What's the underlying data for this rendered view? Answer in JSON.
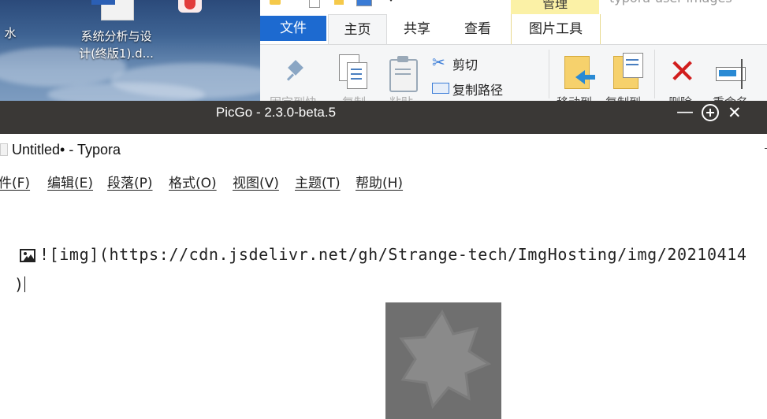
{
  "desktop": {
    "icons": [
      {
        "label_line1": "系统分析与设",
        "label_line2": "计(终版1).d..."
      },
      {
        "label": "水"
      }
    ]
  },
  "explorer": {
    "top_tab": "管理",
    "window_title_partial": "typora-user-images",
    "tabs": [
      "文件",
      "主页",
      "共享",
      "查看",
      "图片工具"
    ],
    "ribbon": {
      "pin_label": "固定到快",
      "copy_label": "复制",
      "paste_label": "粘贴",
      "cut_label": "剪切",
      "copy_path_label": "复制路径",
      "move_to_label": "移动到",
      "copy_to_label": "复制到",
      "delete_label": "删除",
      "rename_label": "重命名"
    }
  },
  "picgo": {
    "title": "PicGo - 2.3.0-beta.5",
    "minimize": "—",
    "close": "✕"
  },
  "typora": {
    "title": "Untitled• - Typora",
    "menu": [
      "件(F)",
      "编辑(E)",
      "段落(P)",
      "格式(O)",
      "视图(V)",
      "主题(T)",
      "帮助(H)"
    ],
    "line1": "![img](https://cdn.jsdelivr.net/gh/Strange-tech/ImgHosting/img/20210414",
    "line2": ")"
  }
}
